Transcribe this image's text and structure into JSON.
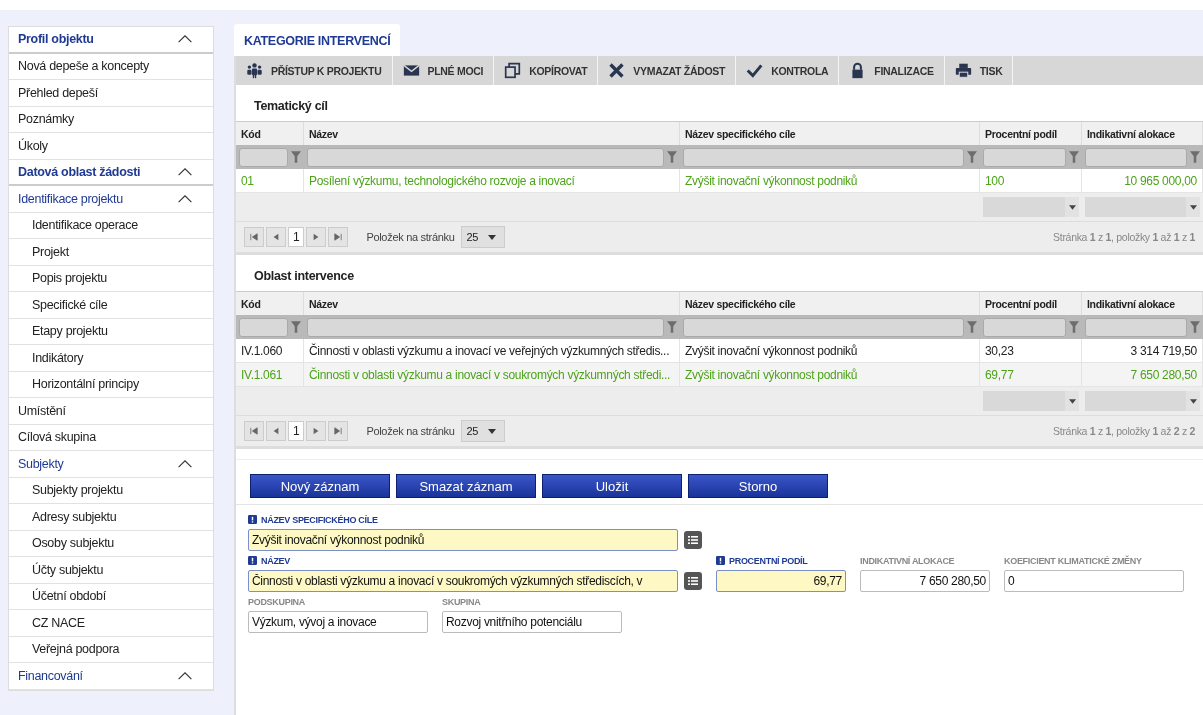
{
  "sidebar": {
    "items": [
      {
        "label": "Profil objektu",
        "expanded": true,
        "children": [
          {
            "label": "Nová depeše a koncepty"
          },
          {
            "label": "Přehled depeší"
          },
          {
            "label": "Poznámky"
          },
          {
            "label": "Úkoly"
          }
        ]
      },
      {
        "label": "Datová oblast žádosti",
        "expanded": true,
        "children": [
          {
            "label": "Identifikace projektu",
            "expanded": true,
            "children": [
              {
                "label": "Identifikace operace"
              },
              {
                "label": "Projekt"
              },
              {
                "label": "Popis projektu"
              },
              {
                "label": "Specifické cíle"
              },
              {
                "label": "Etapy projektu"
              },
              {
                "label": "Indikátory"
              },
              {
                "label": "Horizontální principy"
              }
            ]
          },
          {
            "label": "Umístění"
          },
          {
            "label": "Cílová skupina"
          },
          {
            "label": "Subjekty",
            "expanded": true,
            "children": [
              {
                "label": "Subjekty projektu"
              },
              {
                "label": "Adresy subjektu"
              },
              {
                "label": "Osoby subjektu"
              },
              {
                "label": "Účty subjektu"
              },
              {
                "label": "Účetní období"
              },
              {
                "label": "CZ NACE"
              },
              {
                "label": "Veřejná podpora"
              }
            ]
          },
          {
            "label": "Financování",
            "expanded": true
          }
        ]
      }
    ]
  },
  "tab": {
    "label": "KATEGORIE INTERVENCÍ"
  },
  "toolbar": [
    "PŘÍSTUP K PROJEKTU",
    "PLNÉ MOCI",
    "KOPÍROVAT",
    "VYMAZAT ŽÁDOST",
    "KONTROLA",
    "FINALIZACE",
    "TISK"
  ],
  "tables": [
    {
      "title": "Tematický cíl",
      "columns": [
        "Kód",
        "Název",
        "Název specifického cíle",
        "Procentní podíl",
        "Indikativní alokace"
      ],
      "rows": [
        {
          "selected": true,
          "cells": [
            "01",
            "Posílení výzkumu, technologického rozvoje a inovací",
            "Zvýšit inovační výkonnost podniků",
            "100",
            "10 965 000,00"
          ]
        }
      ],
      "pager": {
        "page": "1",
        "page_size_label": "Položek na stránku",
        "page_size": "25",
        "summary": "Stránka **1** z **1**, položky **1** až **1** z **1**"
      }
    },
    {
      "title": "Oblast intervence",
      "columns": [
        "Kód",
        "Název",
        "Název specifického cíle",
        "Procentní podíl",
        "Indikativní alokace"
      ],
      "rows": [
        {
          "selected": false,
          "cells": [
            "IV.1.060",
            "Činnosti v oblasti výzkumu a inovací ve veřejných výzkumných středis...",
            "Zvýšit inovační výkonnost podniků",
            "30,23",
            "3 314 719,50"
          ]
        },
        {
          "selected": true,
          "cells": [
            "IV.1.061",
            "Činnosti v oblasti výzkumu a inovací v soukromých výzkumných středi...",
            "Zvýšit inovační výkonnost podniků",
            "69,77",
            "7 650 280,50"
          ]
        }
      ],
      "pager": {
        "page": "1",
        "page_size_label": "Položek na stránku",
        "page_size": "25",
        "summary": "Stránka **1** z **1**, položky **1** až **2** z **2**"
      }
    }
  ],
  "buttons": [
    "Nový záznam",
    "Smazat záznam",
    "Uložit",
    "Storno"
  ],
  "form": {
    "rows": [
      [
        {
          "kind": "picker",
          "label": "NÁZEV SPECIFICKÉHO CÍLE",
          "value": "Zvýšit inovační výkonnost podniků",
          "required": true
        }
      ],
      [
        {
          "kind": "picker",
          "label": "NÁZEV",
          "value": "Činnosti v oblasti výzkumu a inovací v soukromých výzkumných střediscích, v",
          "required": true
        },
        {
          "kind": "number",
          "label": "PROCENTNÍ PODÍL",
          "value": "69,77",
          "required": true
        },
        {
          "kind": "number",
          "label": "INDIKATIVNÍ ALOKACE",
          "value": "7 650 280,50",
          "required": false
        },
        {
          "kind": "text",
          "label": "KOEFICIENT KLIMATICKÉ ZMĚNY",
          "value": "0",
          "required": false
        }
      ],
      [
        {
          "kind": "text",
          "label": "PODSKUPINA",
          "value": "Výzkum, vývoj a inovace",
          "required": false
        },
        {
          "kind": "text",
          "label": "SKUPINA",
          "value": "Rozvoj vnitřního potenciálu",
          "required": false
        }
      ]
    ]
  }
}
